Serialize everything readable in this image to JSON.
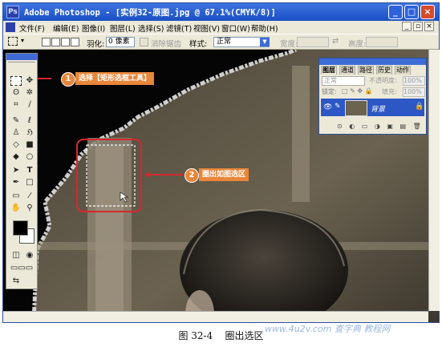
{
  "window": {
    "title": "Adobe Photoshop - [实例32-原图.jpg @ 67.1%(CMYK/8)]"
  },
  "menu": {
    "items": [
      "文件(F)",
      "编辑(E)",
      "图像(I)",
      "图层(L)",
      "选择(S)",
      "滤镜(T)",
      "视图(V)",
      "窗口(W)",
      "帮助(H)"
    ]
  },
  "options": {
    "feather_label": "羽化:",
    "feather_value": "0 像素",
    "antialias_label": "消除锯齿",
    "style_label": "样式:",
    "style_value": "正常",
    "width_label": "宽度:",
    "height_label": "高度:"
  },
  "layers_panel": {
    "tabs": [
      "图层",
      "通道",
      "路径",
      "历史",
      "动作"
    ],
    "blend_mode": "正常",
    "opacity_label": "不透明度:",
    "opacity_value": "100%",
    "lock_label": "锁定:",
    "fill_label": "填充:",
    "fill_value": "100%",
    "layer_name": "背景"
  },
  "callouts": {
    "one_num": "1",
    "one_label": "选择【矩形选框工具】",
    "two_num": "2",
    "two_label": "圈出如图选区"
  },
  "caption": {
    "fig": "图 32-4",
    "text": "圈出选区"
  },
  "watermark": "www.4u2v.com 查字典 教程网",
  "colors": {
    "title_blue": "#1a4fc4",
    "callout_orange": "#e8863a",
    "callout_red": "#d8262e"
  }
}
